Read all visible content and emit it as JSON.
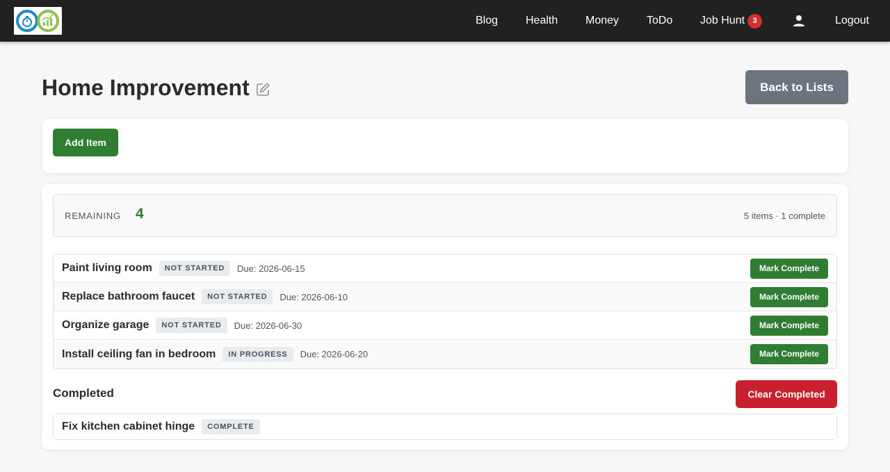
{
  "nav": {
    "links": [
      {
        "label": "Blog"
      },
      {
        "label": "Health"
      },
      {
        "label": "Money"
      },
      {
        "label": "ToDo"
      },
      {
        "label": "Job Hunt",
        "badge": "3"
      }
    ],
    "user_icon": "user-icon",
    "logout_label": "Logout"
  },
  "header": {
    "title": "Home Improvement",
    "edit_icon": "pencil-square-icon",
    "back_label": "Back to Lists"
  },
  "actions": {
    "add_label": "Add Item"
  },
  "summary": {
    "remaining_label": "REMAINING",
    "remaining_count": "4",
    "meta": "5 items · 1 complete"
  },
  "items": [
    {
      "title": "Paint living room",
      "status": "NOT STARTED",
      "due": "Due: 2026-06-15",
      "action": "Mark Complete"
    },
    {
      "title": "Replace bathroom faucet",
      "status": "NOT STARTED",
      "due": "Due: 2026-06-10",
      "action": "Mark Complete"
    },
    {
      "title": "Organize garage",
      "status": "NOT STARTED",
      "due": "Due: 2026-06-30",
      "action": "Mark Complete"
    },
    {
      "title": "Install ceiling fan in bedroom",
      "status": "IN PROGRESS",
      "due": "Due: 2026-06-20",
      "action": "Mark Complete"
    }
  ],
  "completed": {
    "heading": "Completed",
    "clear_label": "Clear Completed",
    "items": [
      {
        "title": "Fix kitchen cabinet hinge",
        "status": "COMPLETE"
      }
    ]
  },
  "colors": {
    "navbar": "#212121",
    "primary_green": "#2e7d32",
    "danger_red": "#c8202f",
    "secondary_gray": "#6c757d",
    "badge_red": "#d32f2f"
  }
}
